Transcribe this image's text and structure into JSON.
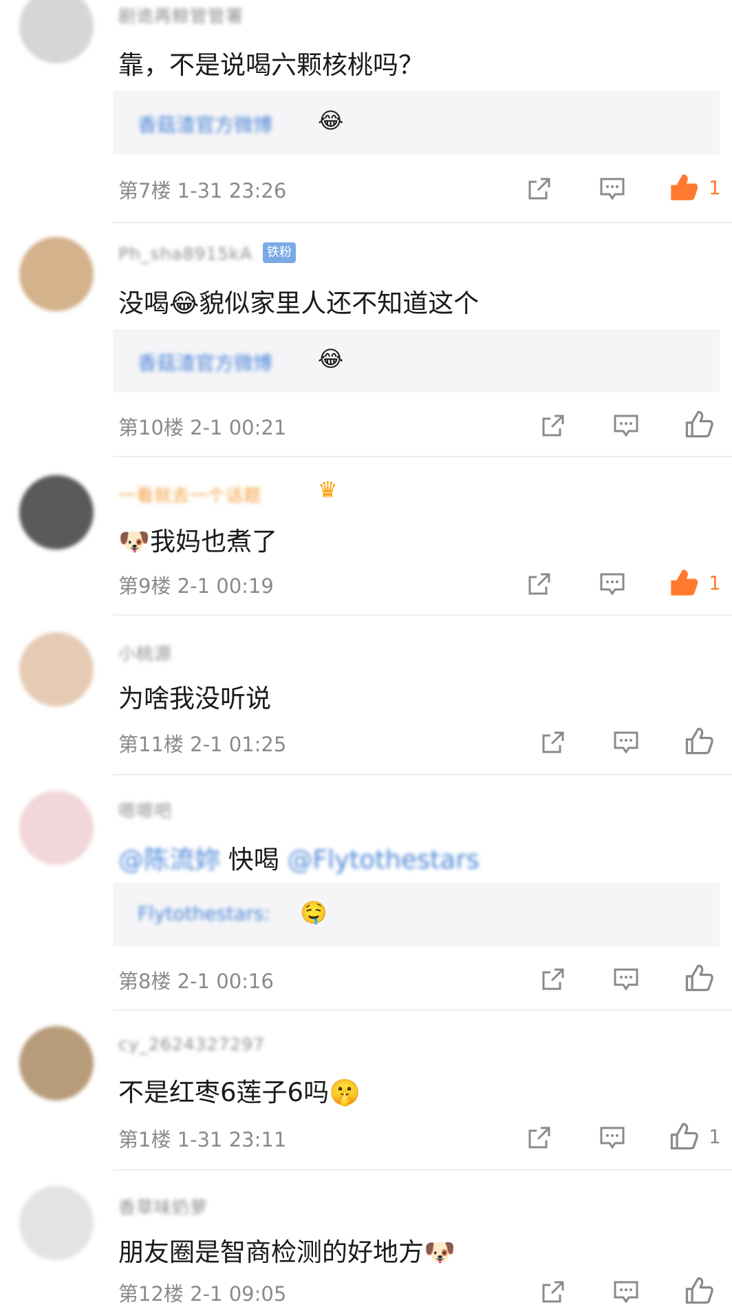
{
  "comments": [
    {
      "username": "剧诡再鲸管管署",
      "text": "靠，不是说喝六颗核桃吗？",
      "quote": {
        "user": "香菇渣官方微博",
        "emoji": "😂"
      },
      "floor": "第7楼",
      "time": "1-31 23:26",
      "likes": "1",
      "liked": true
    },
    {
      "username": "Ph_sha8915kA",
      "badge": "铁粉",
      "text": "没喝😂貌似家里人还不知道这个",
      "quote": {
        "user": "香菇渣官方微博",
        "emoji": "😂"
      },
      "floor": "第10楼",
      "time": "2-1 00:21",
      "likes": "",
      "liked": false
    },
    {
      "username": "一看就去一个话题",
      "text": "🐶我妈也煮了",
      "floor": "第9楼",
      "time": "2-1 00:19",
      "likes": "1",
      "liked": true
    },
    {
      "username": "小桃源",
      "text": "为啥我没听说",
      "floor": "第11楼",
      "time": "2-1 01:25",
      "likes": "",
      "liked": false
    },
    {
      "username": "嗯嗯吧",
      "mention_user": "@陈流妳",
      "text": "快喝",
      "mention_tail": "@Flytothestars",
      "quote": {
        "user": "Flytothestars:",
        "emoji": "🤤"
      },
      "floor": "第8楼",
      "time": "2-1 00:16",
      "likes": "",
      "liked": false
    },
    {
      "username": "cy_2624327297",
      "text": "不是红枣6莲子6吗🤫",
      "floor": "第1楼",
      "time": "1-31 23:11",
      "likes": "1",
      "liked": false
    },
    {
      "username": "香草味奶萝",
      "text": "朋友圈是智商检测的好地方🐶",
      "floor": "第12楼",
      "time": "2-1 09:05",
      "likes": "",
      "liked": false
    }
  ],
  "icons": {
    "repost": "share-square-icon",
    "reply": "comment-bubble-icon",
    "like": "thumbs-up-icon"
  },
  "colors": {
    "liked": "#ff7a2f",
    "muted": "#8a8a8a",
    "link": "#4b86d8",
    "quote_bg": "#f5f5f7"
  }
}
